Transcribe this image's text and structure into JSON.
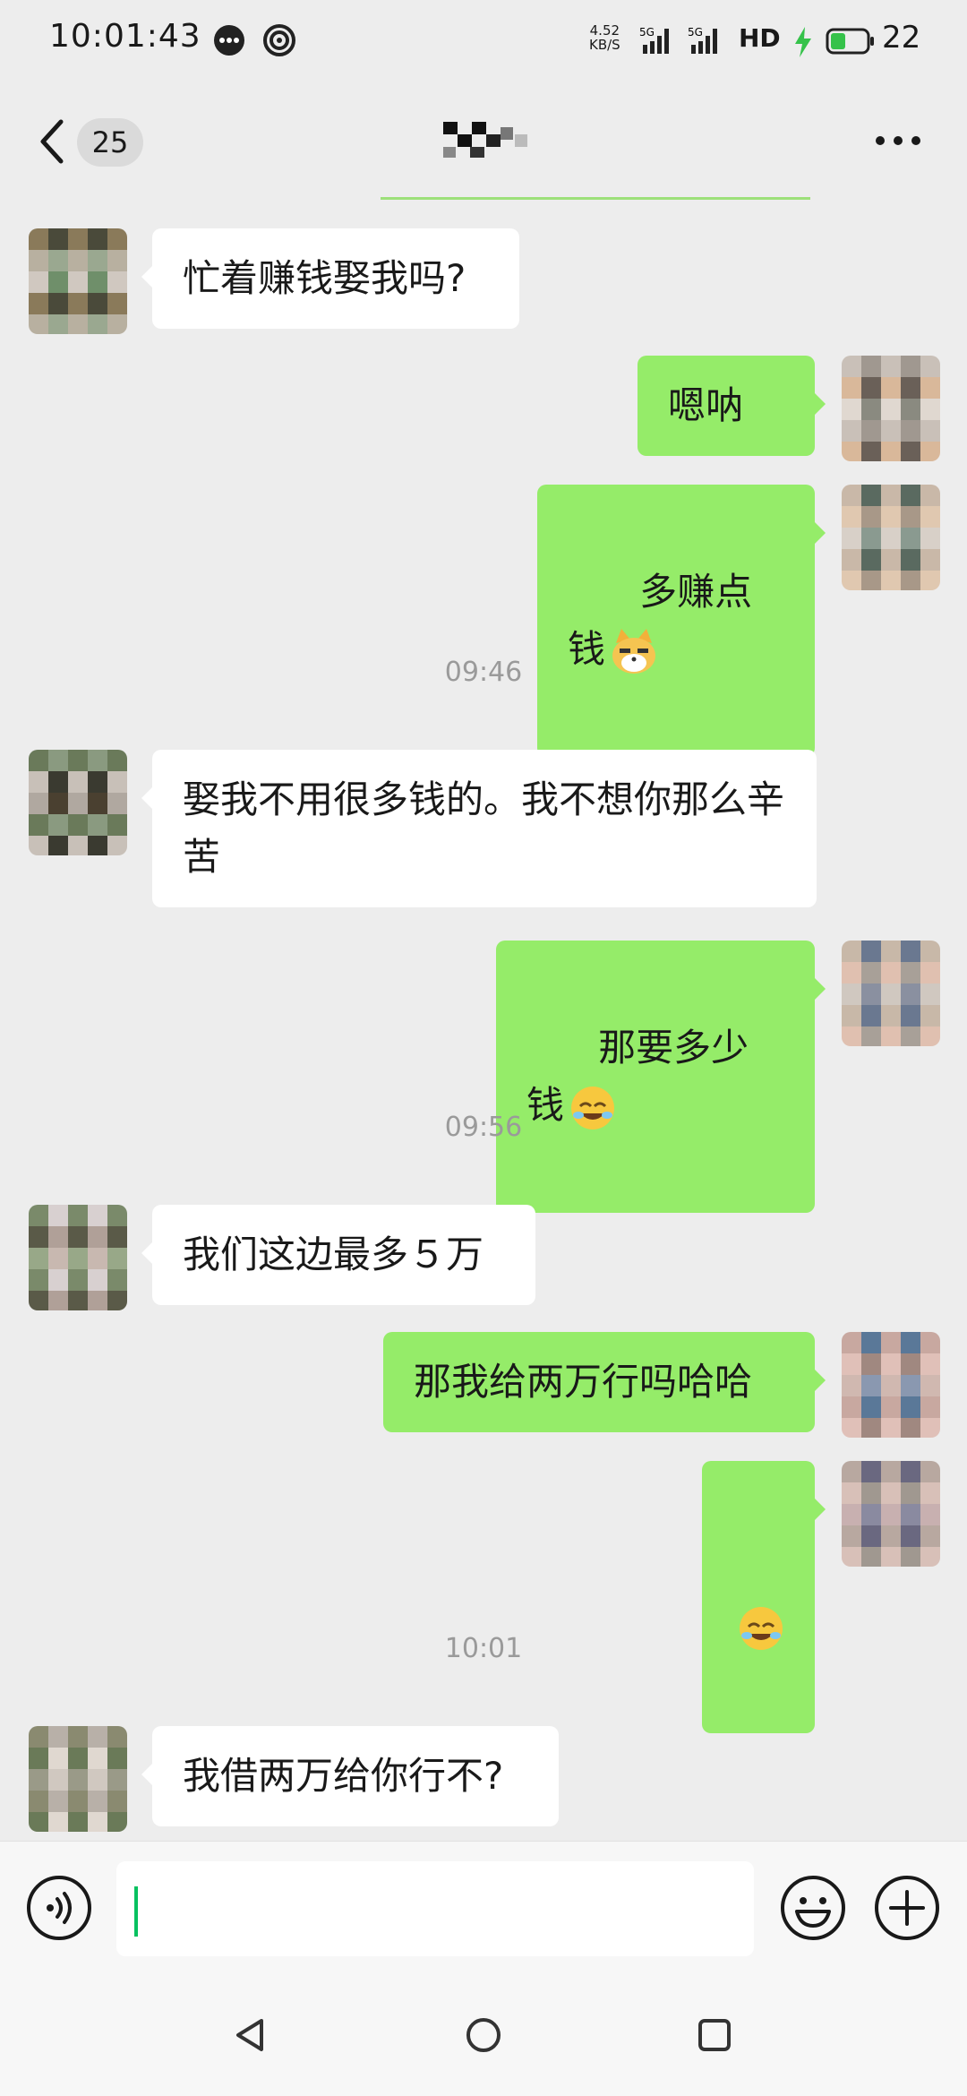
{
  "status_bar": {
    "time": "10:01:43",
    "net_speed_value": "4.52",
    "net_speed_unit": "KB/S",
    "signal1_label": "5G",
    "signal2_label": "5G",
    "hd_label": "HD",
    "battery_percent": "22"
  },
  "header": {
    "unread_count": "25",
    "title_icon": "blurred-contact-name"
  },
  "messages": [
    {
      "side": "left",
      "text": "忙着赚钱娶我吗?"
    },
    {
      "side": "right",
      "text": "嗯呐"
    },
    {
      "side": "right",
      "text": "多赚点钱",
      "emoji": "cat-face"
    },
    {
      "timestamp": "09:46"
    },
    {
      "side": "left",
      "text": "娶我不用很多钱的。我不想你那么辛苦"
    },
    {
      "side": "right",
      "text": "那要多少钱",
      "emoji": "rolling-laughing"
    },
    {
      "timestamp": "09:56"
    },
    {
      "side": "left",
      "text": "我们这边最多５万"
    },
    {
      "side": "right",
      "text": "那我给两万行吗哈哈"
    },
    {
      "side": "right",
      "text": "",
      "emoji": "rolling-laughing"
    },
    {
      "timestamp": "10:01"
    },
    {
      "side": "left",
      "text": "我借两万给你行不?"
    }
  ],
  "input": {
    "value": "",
    "placeholder": ""
  },
  "colors": {
    "background": "#ededed",
    "sent_bubble": "#95ec69",
    "received_bubble": "#ffffff",
    "accent": "#07c160"
  },
  "icons": [
    "back-chevron-icon",
    "more-icon",
    "voice-icon",
    "emoji-icon",
    "plus-icon",
    "nav-back-icon",
    "nav-home-icon",
    "nav-recents-icon"
  ]
}
